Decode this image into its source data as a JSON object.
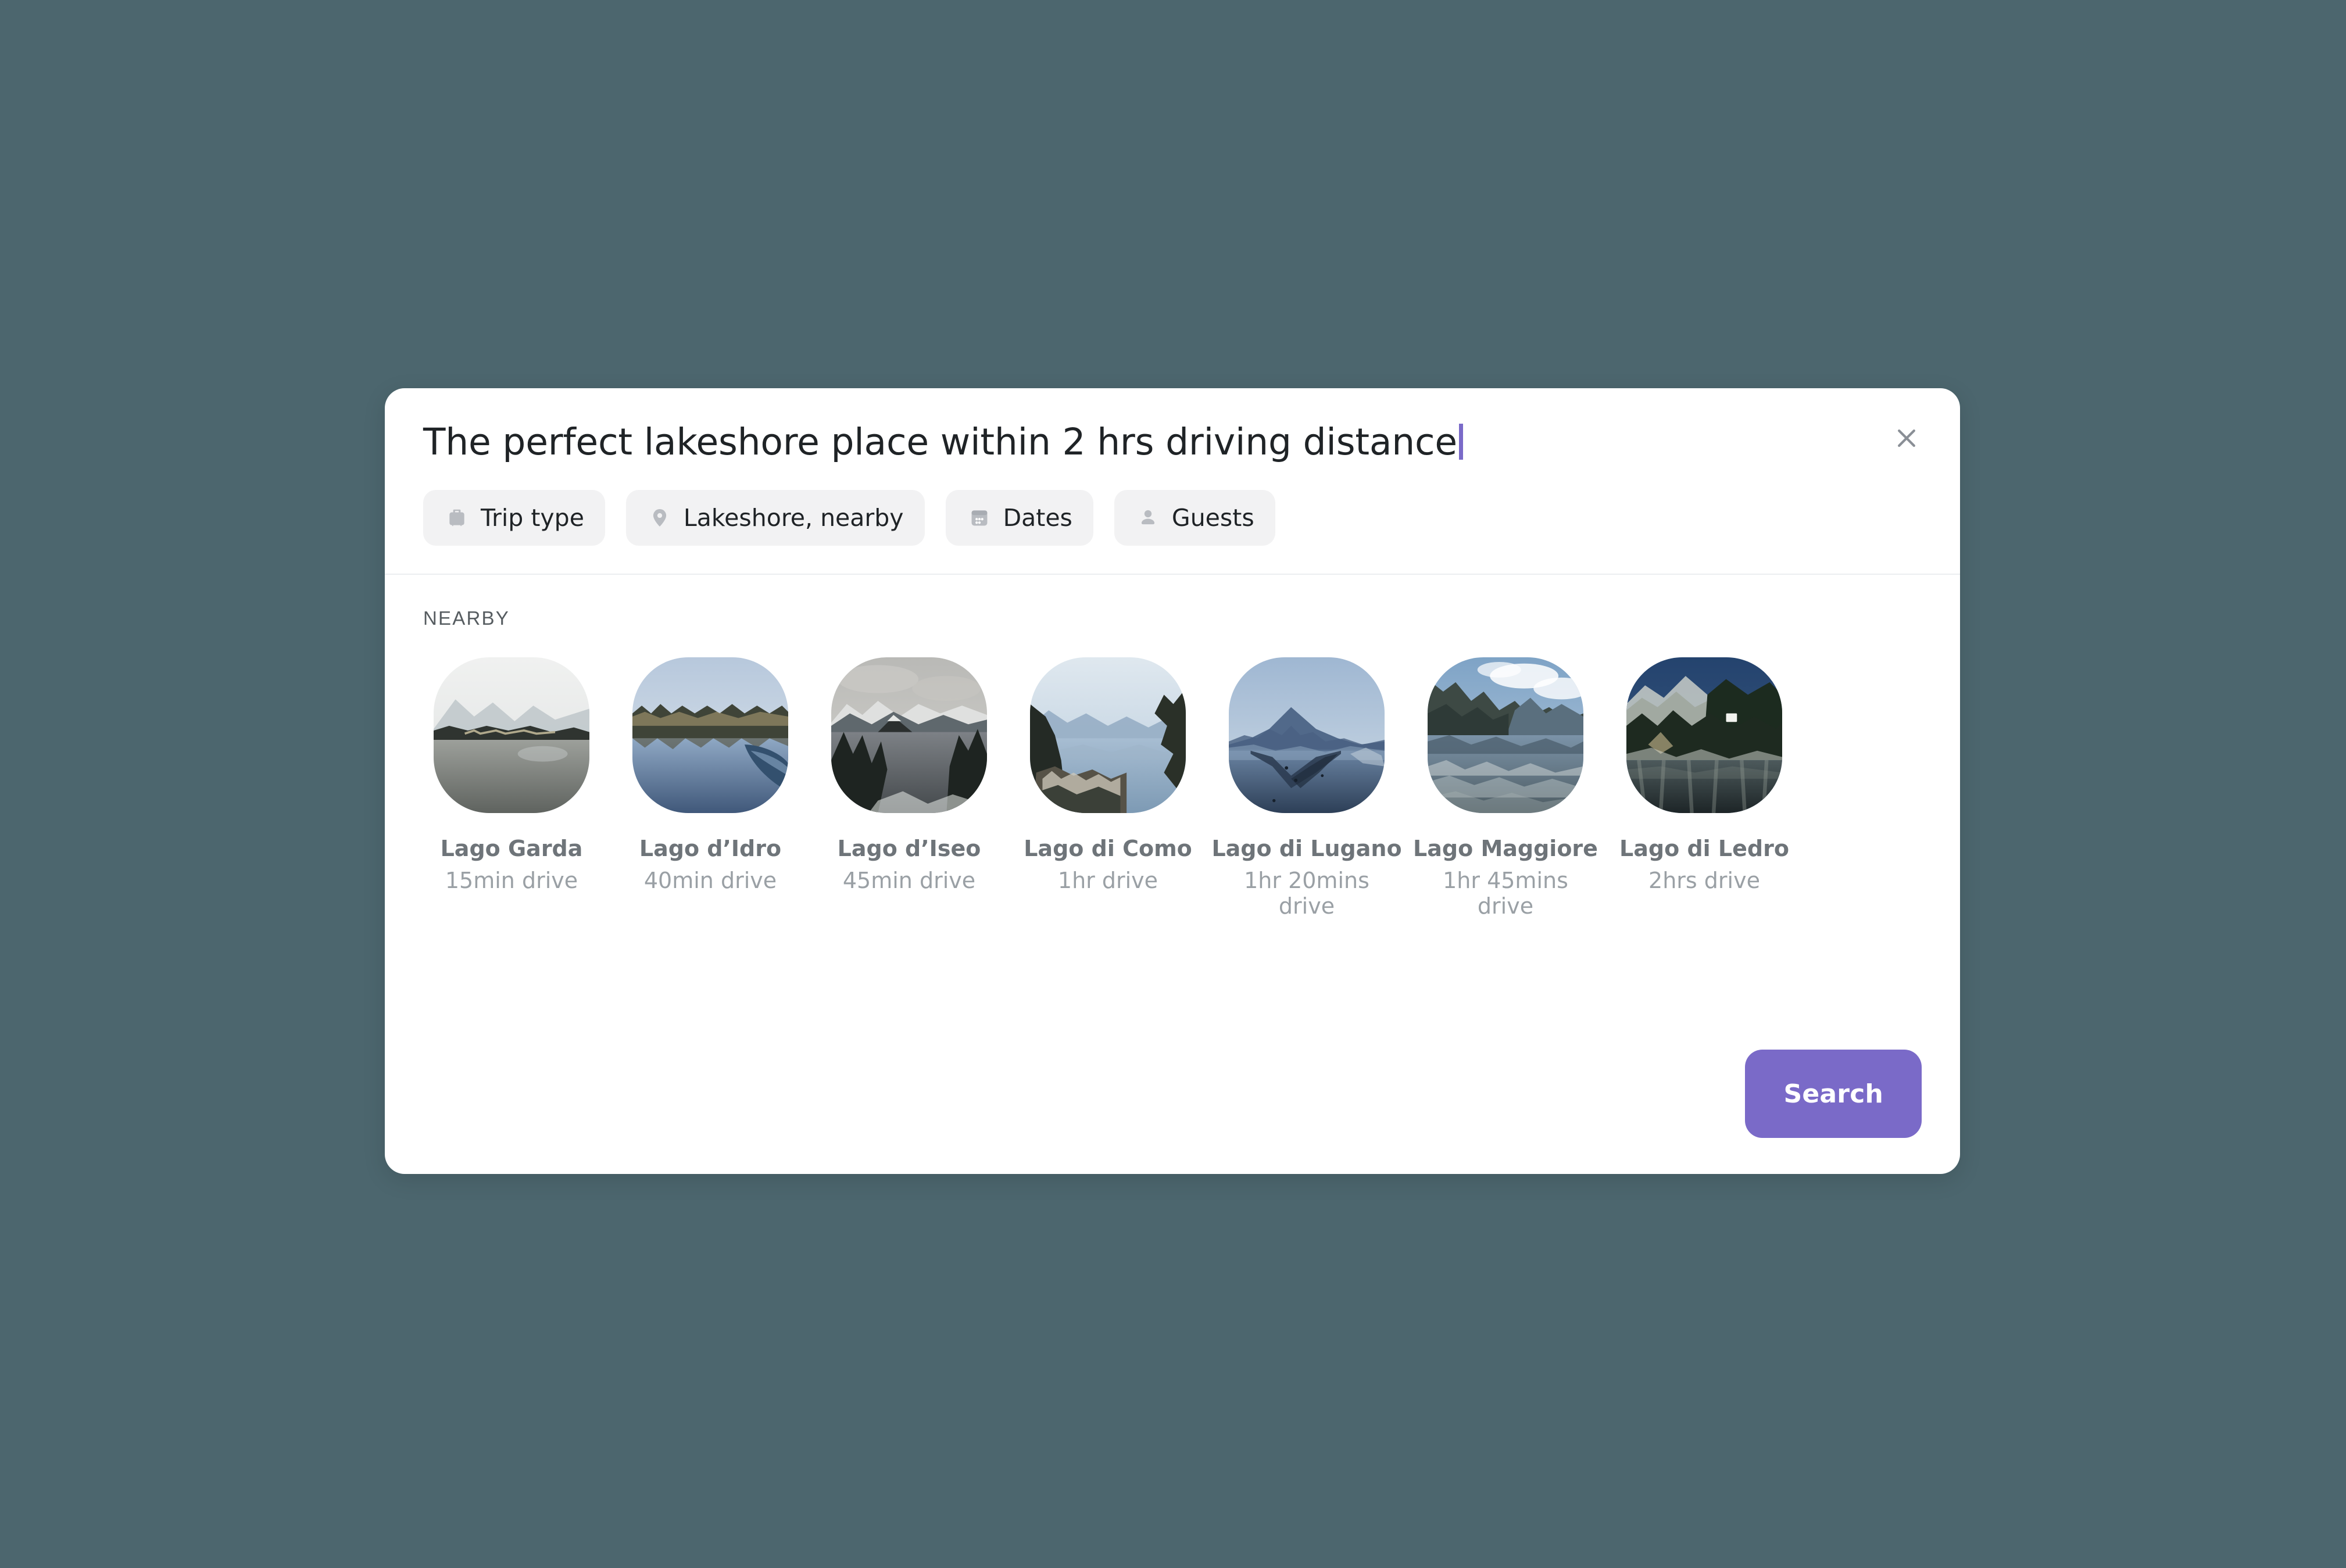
{
  "theme": {
    "page_background": "#4c666e",
    "modal_background": "#ffffff",
    "accent": "#7a6ac8",
    "chip_background": "#f2f2f3",
    "caret_color": "#7a6ac8",
    "muted_text": "#9aa0a5"
  },
  "header": {
    "title": "The perfect lakeshore place within 2 hrs driving distance",
    "close_label": "Close",
    "close_icon": "close-icon"
  },
  "chips": [
    {
      "label": "Trip type",
      "icon": "suitcase-icon"
    },
    {
      "label": "Lakeshore, nearby",
      "icon": "location-pin-icon"
    },
    {
      "label": "Dates",
      "icon": "calendar-icon"
    },
    {
      "label": "Guests",
      "icon": "person-icon"
    }
  ],
  "nearby": {
    "section_label": "NEARBY",
    "places": [
      {
        "name": "Lago Garda",
        "drive": "15min drive",
        "image": "lake-garda-thumbnail"
      },
      {
        "name": "Lago d’Idro",
        "drive": "40min drive",
        "image": "lake-idro-thumbnail"
      },
      {
        "name": "Lago d’Iseo",
        "drive": "45min drive",
        "image": "lake-iseo-thumbnail"
      },
      {
        "name": "Lago di Como",
        "drive": "1hr drive",
        "image": "lake-como-thumbnail"
      },
      {
        "name": "Lago di Lugano",
        "drive": "1hr 20mins drive",
        "image": "lake-lugano-thumbnail"
      },
      {
        "name": "Lago Maggiore",
        "drive": "1hr 45mins drive",
        "image": "lake-maggiore-thumbnail"
      },
      {
        "name": "Lago di Ledro",
        "drive": "2hrs drive",
        "image": "lake-ledro-thumbnail"
      }
    ]
  },
  "footer": {
    "search_label": "Search"
  }
}
